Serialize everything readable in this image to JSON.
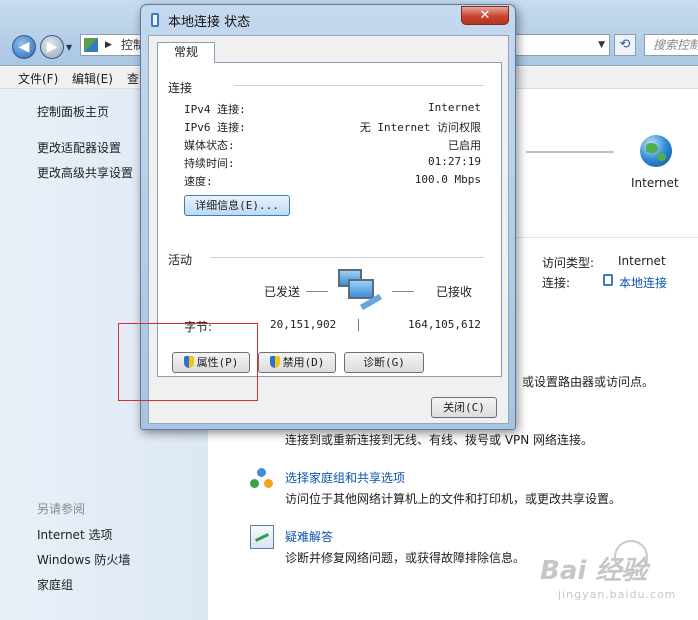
{
  "explorer": {
    "address_text": "控制",
    "search_placeholder": "搜索控制",
    "menu": [
      "文件(F)",
      "编辑(E)",
      "查"
    ],
    "sidebar_links": [
      "控制面板主页",
      "更改适配器设置",
      "更改高级共享设置"
    ],
    "see_also_heading": "另请参阅",
    "see_also_links": [
      "Internet 选项",
      "Windows 防火墙",
      "家庭组"
    ],
    "network_label": "Internet",
    "access_type_label": "访问类型:",
    "access_type_value": "Internet",
    "connection_label": "连接:",
    "connection_value": "本地连接",
    "partial_router_text": "或设置路由器或访问点。",
    "setup_desc": "连接到或重新连接到无线、有线、拨号或 VPN 网络连接。",
    "homegroup_title": "选择家庭组和共享选项",
    "homegroup_desc": "访问位于其他网络计算机上的文件和打印机，或更改共享设置。",
    "troubleshoot_title": "疑难解答",
    "troubleshoot_desc": "诊断并修复网络问题，或获得故障排除信息。"
  },
  "dialog": {
    "title": "本地连接 状态",
    "close_symbol": "✕",
    "tab_label": "常规",
    "connection_group": "连接",
    "rows": [
      {
        "label": "IPv4 连接:",
        "value": "Internet"
      },
      {
        "label": "IPv6 连接:",
        "value": "无 Internet 访问权限"
      },
      {
        "label": "媒体状态:",
        "value": "已启用"
      },
      {
        "label": "持续时间:",
        "value": "01:27:19"
      },
      {
        "label": "速度:",
        "value": "100.0 Mbps"
      }
    ],
    "details_button": "详细信息(E)...",
    "activity_group": "活动",
    "sent_label": "已发送",
    "received_label": "已接收",
    "bytes_label": "字节:",
    "bytes_sent": "20,151,902",
    "bytes_received": "164,105,612",
    "properties_button": "属性(P)",
    "disable_button": "禁用(D)",
    "diagnose_button": "诊断(G)",
    "close_button": "关闭(C)"
  },
  "watermark": {
    "brand": "Bai 经验",
    "url": "jingyan.baidu.com"
  },
  "colors": {
    "highlight_box": "#d9302c",
    "link": "#0a55b0"
  }
}
